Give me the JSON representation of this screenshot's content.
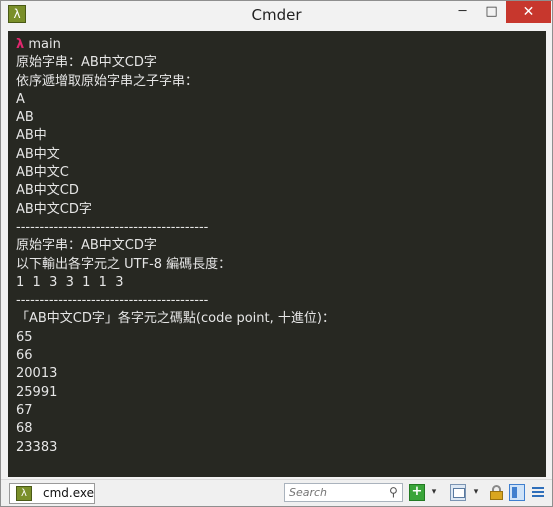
{
  "window": {
    "title": "Cmder",
    "icon": "lambda-icon",
    "app_icon_glyph": "λ",
    "controls": {
      "minimize": "─",
      "maximize": "□",
      "close": "✕"
    }
  },
  "terminal": {
    "prompt_symbol": "λ",
    "prompt_dir": "main",
    "lines": [
      "原始字串：AB中文CD字",
      "依序遞增取原始字串之子字串：",
      "A",
      "AB",
      "AB中",
      "AB中文",
      "AB中文C",
      "AB中文CD",
      "AB中文CD字",
      "-----------------------------------------",
      "原始字串：AB中文CD字",
      "以下輸出各字元之 UTF-8 編碼長度：",
      "1  1  3  3  1  1  3",
      "-----------------------------------------",
      "「AB中文CD字」各字元之碼點(code point, 十進位)：",
      "65",
      "66",
      "20013",
      "25991",
      "67",
      "68",
      "23383"
    ]
  },
  "statusbar": {
    "tab_label": "cmd.exe",
    "tab_icon_glyph": "λ",
    "search_placeholder": "Search",
    "search_icon_glyph": "⚲",
    "new_console_glyph": "+",
    "dropdown_glyph": "▾"
  },
  "colors": {
    "terminal_bg": "#272822",
    "prompt_symbol": "#e0276e",
    "close_button": "#c7372d",
    "app_icon": "#7a8f2a",
    "new_console": "#3aa53a"
  }
}
